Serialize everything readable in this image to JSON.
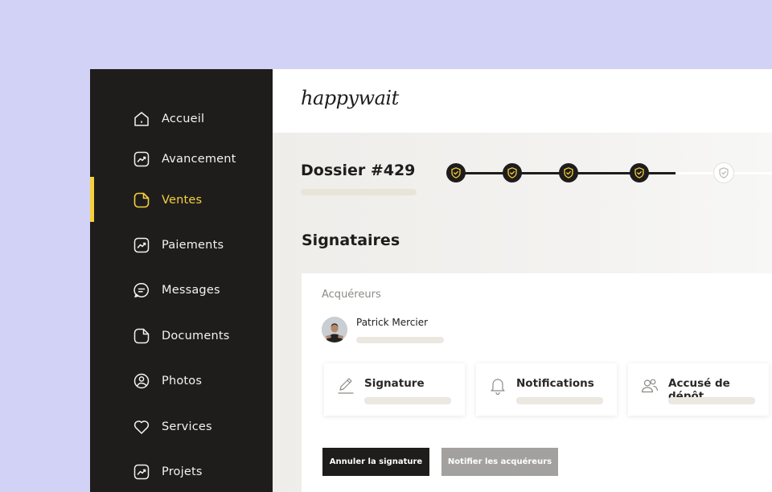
{
  "logo": "happywait",
  "sidebar": {
    "items": [
      {
        "label": "Accueil",
        "icon": "home-icon"
      },
      {
        "label": "Avancement",
        "icon": "chart-icon"
      },
      {
        "label": "Ventes",
        "icon": "document-icon",
        "active": true
      },
      {
        "label": "Paiements",
        "icon": "chart-icon"
      },
      {
        "label": "Messages",
        "icon": "message-icon"
      },
      {
        "label": "Documents",
        "icon": "document-icon"
      },
      {
        "label": "Photos",
        "icon": "photo-icon"
      },
      {
        "label": "Services",
        "icon": "heart-icon"
      },
      {
        "label": "Projets",
        "icon": "chart-icon"
      }
    ]
  },
  "dossier": {
    "title": "Dossier #429",
    "steps_completed": 4,
    "steps_total": 5
  },
  "signataires": {
    "title": "Signataires",
    "group_label": "Acquéreurs",
    "person_name": "Patrick Mercier"
  },
  "tiles": [
    {
      "label": "Signature",
      "icon": "pen-icon"
    },
    {
      "label": "Notifications",
      "icon": "bell-icon"
    },
    {
      "label": "Accusé de dépôt",
      "icon": "users-icon"
    }
  ],
  "buttons": {
    "cancel_label": "Annuler la signature",
    "notify_label": "Notifier les acquéreurs"
  },
  "colors": {
    "accent": "#f4d13d",
    "sidebar_bg": "#1f1d1c",
    "page_bg": "#d2d2f6"
  }
}
